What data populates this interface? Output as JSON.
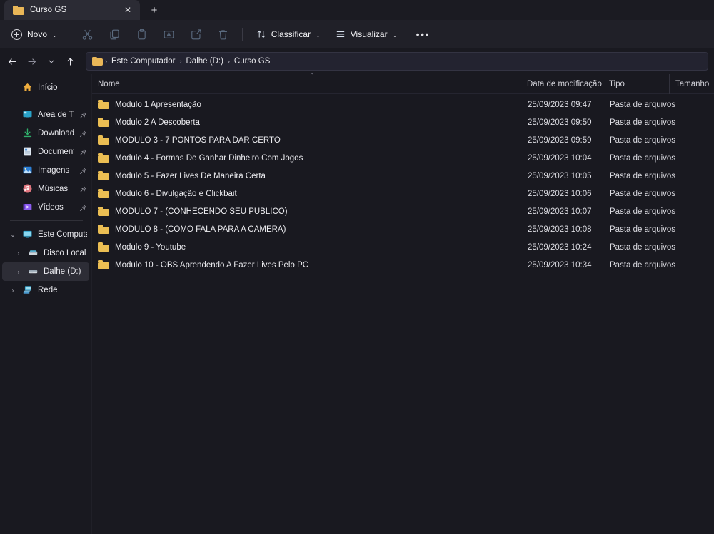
{
  "window": {
    "tab_title": "Curso GS",
    "tab_close_glyph": "✕",
    "new_tab_glyph": "+"
  },
  "toolbar": {
    "new_label": "Novo",
    "new_chevron": "⌄",
    "sort_label": "Classificar",
    "sort_chevron": "⌄",
    "view_label": "Visualizar",
    "view_chevron": "⌄",
    "more_label": "•••",
    "icons": [
      {
        "name": "cut-icon",
        "tooltip": "Recortar"
      },
      {
        "name": "copy-icon",
        "tooltip": "Copiar"
      },
      {
        "name": "paste-icon",
        "tooltip": "Colar"
      },
      {
        "name": "rename-icon",
        "tooltip": "Renomear"
      },
      {
        "name": "share-icon",
        "tooltip": "Compartilhar"
      },
      {
        "name": "delete-icon",
        "tooltip": "Excluir"
      }
    ]
  },
  "nav": {
    "back_glyph": "←",
    "forward_glyph": "→",
    "recent_glyph": "⌄",
    "up_glyph": "↑",
    "breadcrumb": [
      "Este Computador",
      "Dalhe (D:)",
      "Curso GS"
    ],
    "breadcrumb_separator": "›"
  },
  "sidebar": {
    "home": {
      "label": "Início",
      "icon": "home-icon"
    },
    "quick_access": [
      {
        "label": "Área de Trabalho",
        "icon": "desktop-icon",
        "pinned": true
      },
      {
        "label": "Downloads",
        "icon": "downloads-icon",
        "pinned": true
      },
      {
        "label": "Documentos",
        "icon": "documents-icon",
        "pinned": true
      },
      {
        "label": "Imagens",
        "icon": "pictures-icon",
        "pinned": true
      },
      {
        "label": "Músicas",
        "icon": "music-icon",
        "pinned": true
      },
      {
        "label": "Vídeos",
        "icon": "videos-icon",
        "pinned": true
      }
    ],
    "tree": [
      {
        "label": "Este Computador",
        "icon": "this-pc-icon",
        "expanded": true,
        "twisty": "⌄",
        "level": 0,
        "selected": false
      },
      {
        "label": "Disco Local (C:)",
        "icon": "drive-icon",
        "expanded": false,
        "twisty": "›",
        "level": 1,
        "selected": false
      },
      {
        "label": "Dalhe (D:)",
        "icon": "drive-icon",
        "expanded": false,
        "twisty": "›",
        "level": 1,
        "selected": true
      },
      {
        "label": "Rede",
        "icon": "network-icon",
        "expanded": false,
        "twisty": "›",
        "level": 0,
        "selected": false
      }
    ]
  },
  "file_list": {
    "sort_indicator": "⌃",
    "columns": [
      {
        "key": "name",
        "label": "Nome"
      },
      {
        "key": "date",
        "label": "Data de modificação"
      },
      {
        "key": "type",
        "label": "Tipo"
      },
      {
        "key": "size",
        "label": "Tamanho"
      }
    ],
    "rows": [
      {
        "name": "Modulo 1 Apresentação",
        "date": "25/09/2023 09:47",
        "type": "Pasta de arquivos",
        "size": ""
      },
      {
        "name": "Modulo 2 A Descoberta",
        "date": "25/09/2023 09:50",
        "type": "Pasta de arquivos",
        "size": ""
      },
      {
        "name": "MODULO 3 - 7 PONTOS PARA DAR CERTO",
        "date": "25/09/2023 09:59",
        "type": "Pasta de arquivos",
        "size": ""
      },
      {
        "name": "Modulo 4 - Formas De Ganhar Dinheiro Com Jogos",
        "date": "25/09/2023 10:04",
        "type": "Pasta de arquivos",
        "size": ""
      },
      {
        "name": "Modulo 5 - Fazer Lives De Maneira Certa",
        "date": "25/09/2023 10:05",
        "type": "Pasta de arquivos",
        "size": ""
      },
      {
        "name": "Modulo 6 - Divulgação e Clickbait",
        "date": "25/09/2023 10:06",
        "type": "Pasta de arquivos",
        "size": ""
      },
      {
        "name": "MODULO 7 - (CONHECENDO SEU PUBLICO)",
        "date": "25/09/2023 10:07",
        "type": "Pasta de arquivos",
        "size": ""
      },
      {
        "name": "MODULO 8 - (COMO FALA PARA A CAMERA)",
        "date": "25/09/2023 10:08",
        "type": "Pasta de arquivos",
        "size": ""
      },
      {
        "name": "Modulo 9 - Youtube",
        "date": "25/09/2023 10:24",
        "type": "Pasta de arquivos",
        "size": ""
      },
      {
        "name": "Modulo 10 - OBS Aprendendo A Fazer Lives Pelo PC",
        "date": "25/09/2023 10:34",
        "type": "Pasta de arquivos",
        "size": ""
      }
    ]
  },
  "colors": {
    "folder_yellow": "#ebbe53",
    "window_bg": "#191920",
    "toolbar_bg": "#202028",
    "selection_bg": "#2d2d36"
  }
}
